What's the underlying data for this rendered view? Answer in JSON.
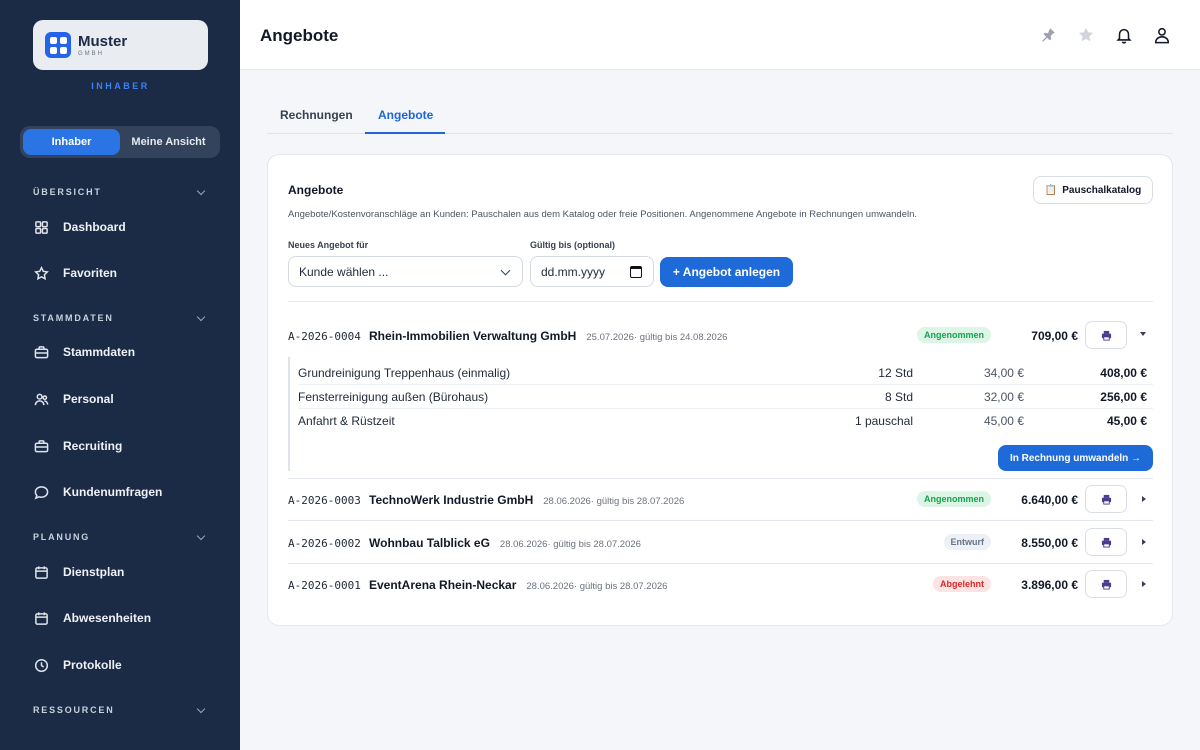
{
  "brand": {
    "name": "Muster",
    "sub": "GMBH",
    "role": "INHABER"
  },
  "role_toggle": {
    "options": [
      "Inhaber",
      "Meine Ansicht"
    ],
    "active": "Inhaber"
  },
  "sidebar": {
    "sections": [
      {
        "title": "ÜBERSICHT",
        "items": [
          {
            "label": "Dashboard",
            "icon": "grid-icon"
          },
          {
            "label": "Favoriten",
            "icon": "star-icon"
          }
        ]
      },
      {
        "title": "STAMMDATEN",
        "items": [
          {
            "label": "Stammdaten",
            "icon": "briefcase-icon"
          },
          {
            "label": "Personal",
            "icon": "users-icon"
          },
          {
            "label": "Recruiting",
            "icon": "briefcase-icon"
          },
          {
            "label": "Kundenumfragen",
            "icon": "chat-icon"
          }
        ]
      },
      {
        "title": "PLANUNG",
        "items": [
          {
            "label": "Dienstplan",
            "icon": "calendar-icon"
          },
          {
            "label": "Abwesenheiten",
            "icon": "calendar-icon"
          },
          {
            "label": "Protokolle",
            "icon": "clock-icon"
          }
        ]
      },
      {
        "title": "RESSOURCEN",
        "items": []
      }
    ]
  },
  "header": {
    "title": "Angebote"
  },
  "tabs": {
    "items": [
      "Rechnungen",
      "Angebote"
    ],
    "active": "Angebote"
  },
  "card": {
    "title": "Angebote",
    "description": "Angebote/Kostenvoranschläge an Kunden: Pauschalen aus dem Katalog oder freie Positionen. Angenommene Angebote in Rechnungen umwandeln.",
    "katalog_button": "Pauschalkatalog",
    "form": {
      "customer_label": "Neues Angebot für",
      "customer_placeholder": "Kunde wählen ...",
      "valid_label": "Gültig bis (optional)",
      "valid_placeholder": "dd.mm.yyyy",
      "create_button": "+ Angebot anlegen"
    }
  },
  "offers": [
    {
      "number": "A-2026-0004",
      "customer": "Rhein-Immobilien Verwaltung GmbH",
      "meta": "25.07.2026· gültig bis 24.08.2026",
      "status": "Angenommen",
      "status_type": "ok",
      "total": "709,00 €",
      "expanded": true,
      "positions": [
        {
          "desc": "Grundreinigung Treppenhaus (einmalig)",
          "qty": "12 Std",
          "price": "34,00 €",
          "total": "408,00 €"
        },
        {
          "desc": "Fensterreinigung außen (Bürohaus)",
          "qty": "8 Std",
          "price": "32,00 €",
          "total": "256,00 €"
        },
        {
          "desc": "Anfahrt & Rüstzeit",
          "qty": "1 pauschal",
          "price": "45,00 €",
          "total": "45,00 €"
        }
      ],
      "convert_button": "In Rechnung umwandeln →"
    },
    {
      "number": "A-2026-0003",
      "customer": "TechnoWerk Industrie GmbH",
      "meta": "28.06.2026· gültig bis 28.07.2026",
      "status": "Angenommen",
      "status_type": "ok",
      "total": "6.640,00 €",
      "expanded": false
    },
    {
      "number": "A-2026-0002",
      "customer": "Wohnbau Talblick eG",
      "meta": "28.06.2026· gültig bis 28.07.2026",
      "status": "Entwurf",
      "status_type": "draft",
      "total": "8.550,00 €",
      "expanded": false
    },
    {
      "number": "A-2026-0001",
      "customer": "EventArena Rhein-Neckar",
      "meta": "28.06.2026· gültig bis 28.07.2026",
      "status": "Abgelehnt",
      "status_type": "no",
      "total": "3.896,00 €",
      "expanded": false
    }
  ],
  "colors": {
    "sidebar": "#1b2a45",
    "accent": "#1d6ad8",
    "accepted": "#16a34a",
    "rejected": "#dc2626",
    "draft": "#64748b"
  }
}
